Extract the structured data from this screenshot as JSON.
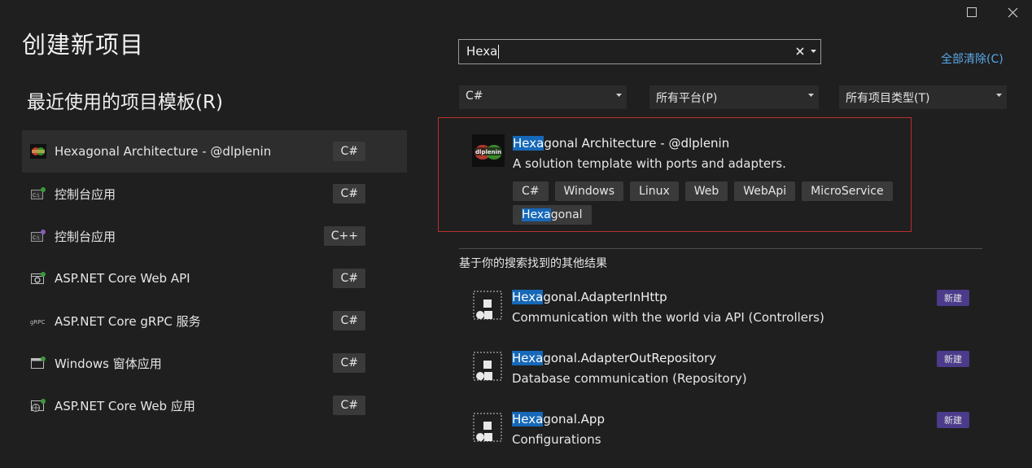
{
  "window": {
    "maximize_icon": "maximize-icon",
    "close_icon": "close-icon"
  },
  "page_title": "创建新项目",
  "recent": {
    "heading": "最近使用的项目模板(R)",
    "items": [
      {
        "label": "Hexagonal Architecture - @dlplenin",
        "lang": "C#",
        "icon": "hexagonal-logo-icon",
        "selected": true
      },
      {
        "label": "控制台应用",
        "lang": "C#",
        "icon": "console-app-icon"
      },
      {
        "label": "控制台应用",
        "lang": "C++",
        "icon": "console-app-icon"
      },
      {
        "label": "ASP.NET Core Web API",
        "lang": "C#",
        "icon": "web-api-icon"
      },
      {
        "label": "ASP.NET Core gRPC 服务",
        "lang": "C#",
        "icon": "grpc-icon"
      },
      {
        "label": "Windows 窗体应用",
        "lang": "C#",
        "icon": "windows-forms-icon"
      },
      {
        "label": "ASP.NET Core Web 应用",
        "lang": "C#",
        "icon": "web-app-icon"
      }
    ]
  },
  "search": {
    "value": "Hexa",
    "clear_icon": "clear-icon",
    "dropdown_icon": "dropdown-arrow-icon"
  },
  "clear_all_label": "全部清除(C)",
  "filters": {
    "language": "C#",
    "platform": "所有平台(P)",
    "project_type": "所有项目类型(T)"
  },
  "top_result": {
    "name_highlight": "Hexa",
    "name_rest": "gonal Architecture - @dlplenin",
    "description": "A solution template with ports and adapters.",
    "logo_text": "dlplenin",
    "tags": [
      {
        "text": "C#"
      },
      {
        "text": "Windows"
      },
      {
        "text": "Linux"
      },
      {
        "text": "Web"
      },
      {
        "text": "WebApi"
      },
      {
        "text": "MicroService"
      },
      {
        "highlight": "Hexa",
        "rest": "gonal"
      }
    ]
  },
  "other_results": {
    "heading": "基于你的搜索找到的其他结果",
    "items": [
      {
        "name_highlight": "Hexa",
        "name_rest": "gonal.AdapterInHttp",
        "description": "Communication with the world via API (Controllers)",
        "badge": "新建"
      },
      {
        "name_highlight": "Hexa",
        "name_rest": "gonal.AdapterOutRepository",
        "description": "Database communication (Repository)",
        "badge": "新建"
      },
      {
        "name_highlight": "Hexa",
        "name_rest": "gonal.App",
        "description": "Configurations",
        "badge": "新建"
      }
    ]
  },
  "colors": {
    "background": "#1f1f1f",
    "highlight": "#1668b8",
    "selection_border": "#b8302e",
    "link": "#5aa8e6",
    "new_badge": "#4b3b8a"
  }
}
